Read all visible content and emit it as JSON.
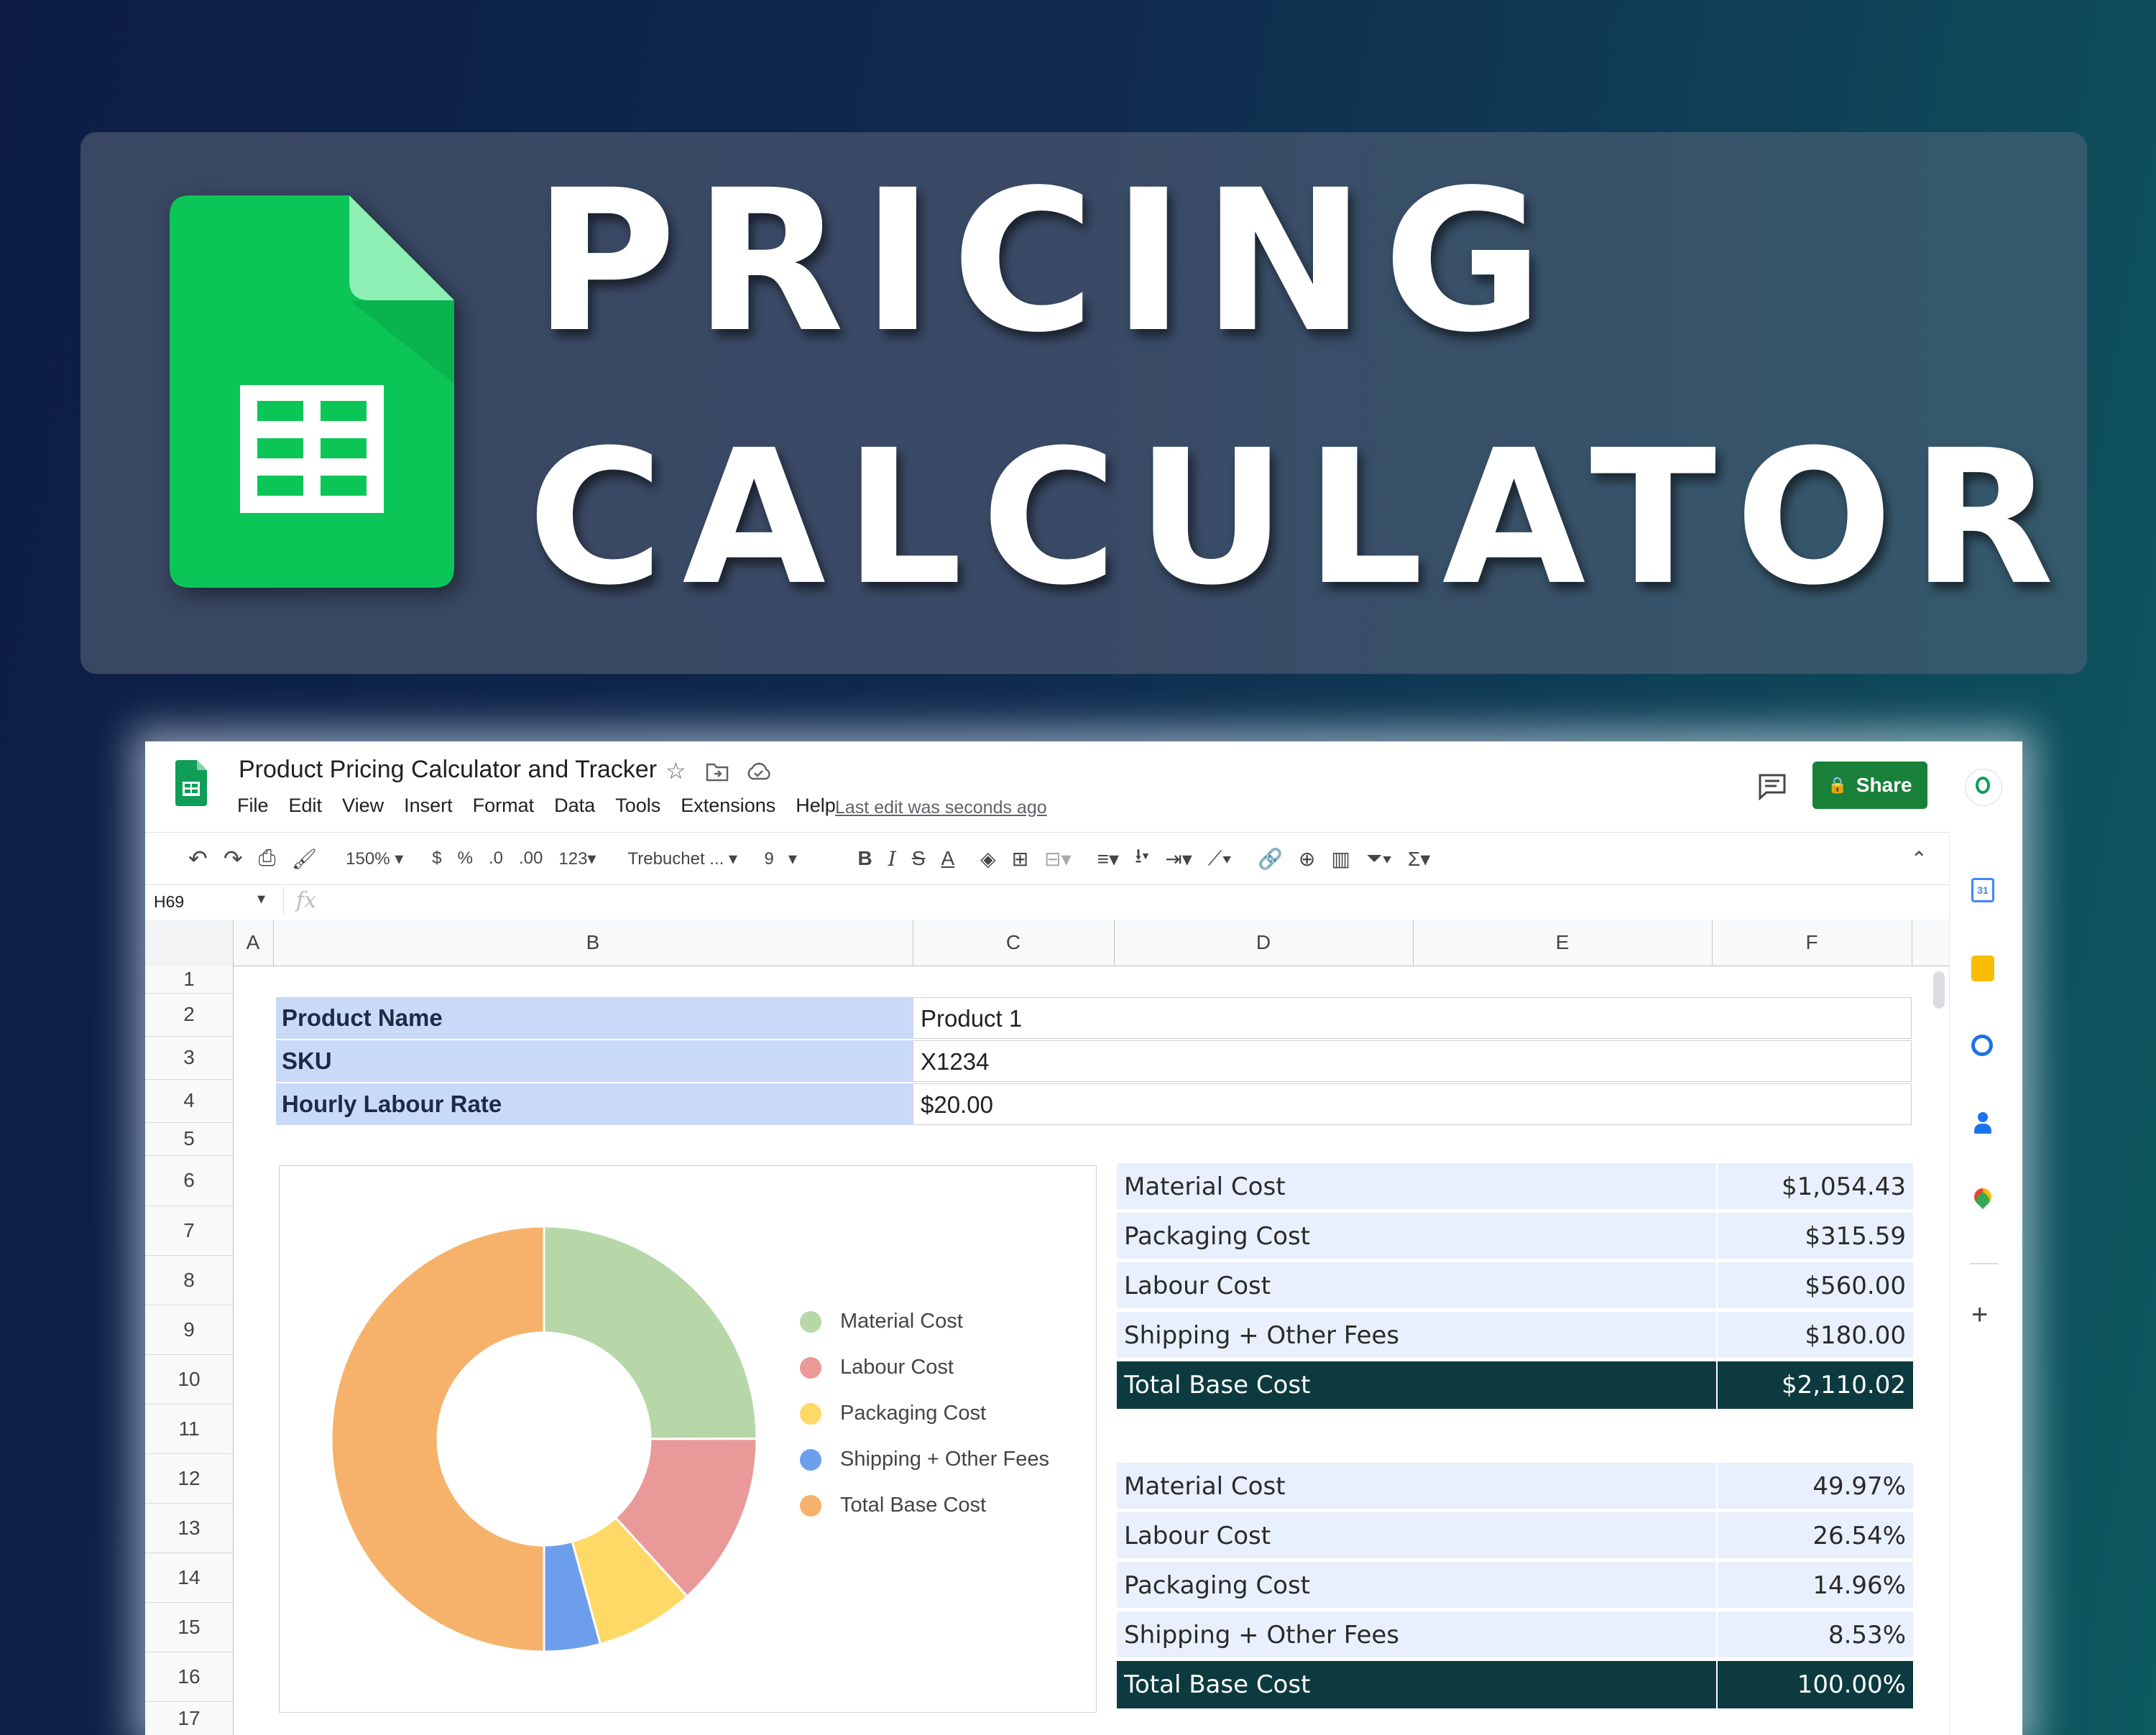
{
  "banner": {
    "title_line1": "PRICING",
    "title_line2": "CALCULATOR",
    "logo_icon": "google-sheets-icon"
  },
  "app": {
    "doc_title": "Product Pricing Calculator and Tracker",
    "menu": [
      "File",
      "Edit",
      "View",
      "Insert",
      "Format",
      "Data",
      "Tools",
      "Extensions",
      "Help"
    ],
    "last_edit": "Last edit was seconds ago",
    "share_label": "Share",
    "brand_color": "#188038"
  },
  "toolbar": {
    "zoom": "150%",
    "currency": "$",
    "percent": "%",
    "dec_decrease": ".0",
    "dec_increase": ".00",
    "number_format": "123",
    "font": "Trebuchet ...",
    "font_size": "9",
    "bold": "B",
    "italic": "I",
    "strike": "S",
    "text_color": "A",
    "sum": "Σ"
  },
  "formula_bar": {
    "cell_ref": "H69",
    "fx": "fx"
  },
  "grid": {
    "columns": [
      "A",
      "B",
      "C",
      "D",
      "E",
      "F"
    ],
    "rows": [
      "1",
      "2",
      "3",
      "4",
      "5",
      "6",
      "7",
      "8",
      "9",
      "10",
      "11",
      "12",
      "13",
      "14",
      "15",
      "16",
      "17"
    ]
  },
  "product": {
    "name_label": "Product Name",
    "name_value": "Product 1",
    "sku_label": "SKU",
    "sku_value": "X1234",
    "rate_label": "Hourly Labour Rate",
    "rate_value": "$20.00"
  },
  "cost_table": [
    {
      "label": "Material Cost",
      "value": "$1,054.43"
    },
    {
      "label": "Packaging Cost",
      "value": "$315.59"
    },
    {
      "label": "Labour Cost",
      "value": "$560.00"
    },
    {
      "label": "Shipping + Other Fees",
      "value": "$180.00"
    },
    {
      "label": "Total Base Cost",
      "value": "$2,110.02"
    }
  ],
  "percent_table": [
    {
      "label": "Material Cost",
      "value": "49.97%"
    },
    {
      "label": "Labour Cost",
      "value": "26.54%"
    },
    {
      "label": "Packaging Cost",
      "value": "14.96%"
    },
    {
      "label": "Shipping + Other Fees",
      "value": "8.53%"
    },
    {
      "label": "Total Base Cost",
      "value": "100.00%"
    }
  ],
  "chart_data": {
    "type": "pie",
    "donut": true,
    "categories": [
      "Material Cost",
      "Labour Cost",
      "Packaging Cost",
      "Shipping + Other Fees",
      "Total Base Cost"
    ],
    "values": [
      1054.43,
      560.0,
      315.59,
      180.0,
      2110.02
    ],
    "colors": [
      "#b7d7a8",
      "#ea9999",
      "#ffd966",
      "#6d9eeb",
      "#f6b26b"
    ],
    "legend_position": "right"
  },
  "colors": {
    "table_light": "#e8f0fd",
    "table_dark": "#0c3a3f",
    "label_fill": "#c9daf8"
  }
}
